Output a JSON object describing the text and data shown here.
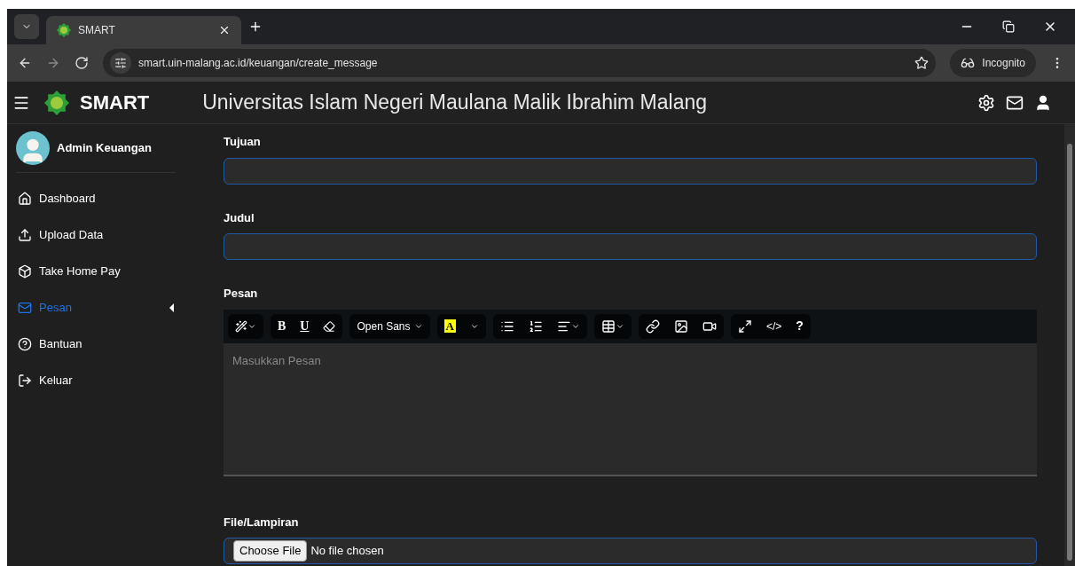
{
  "browser": {
    "tab_title": "SMART",
    "url": "smart.uin-malang.ac.id/keuangan/create_message",
    "incognito": "Incognito"
  },
  "header": {
    "brand": "SMART",
    "title": "Universitas Islam Negeri Maulana Malik Ibrahim Malang"
  },
  "sidebar": {
    "user": "Admin Keuangan",
    "items": [
      {
        "kind": "home",
        "label": "Dashboard",
        "selected": false
      },
      {
        "kind": "upload",
        "label": "Upload Data",
        "selected": false
      },
      {
        "kind": "box",
        "label": "Take Home Pay",
        "selected": false
      },
      {
        "kind": "mail",
        "label": "Pesan",
        "selected": true
      },
      {
        "kind": "help",
        "label": "Bantuan",
        "selected": false
      },
      {
        "kind": "logout",
        "label": "Keluar",
        "selected": false
      }
    ]
  },
  "form": {
    "tujuan": {
      "label": "Tujuan"
    },
    "judul": {
      "label": "Judul"
    },
    "pesan": {
      "label": "Pesan",
      "placeholder": "Masukkan Pesan",
      "toolbar": {
        "bold": "B",
        "underline": "U",
        "font": "Open Sans",
        "highlight": "A",
        "code": "</>",
        "help": "?"
      }
    },
    "file": {
      "label": "File/Lampiran",
      "button": "Choose File",
      "status": "No file chosen"
    }
  }
}
